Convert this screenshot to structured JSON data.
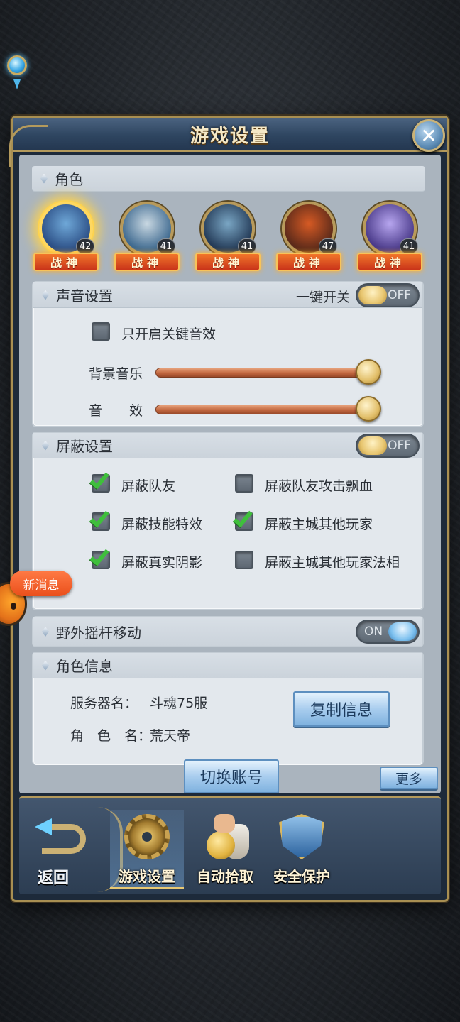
{
  "title": "游戏设置",
  "characters_section": {
    "label": "角色",
    "characters": [
      {
        "level": "42",
        "rank": "战神",
        "colors": [
          "#2c4f86",
          "#6fa8d8"
        ]
      },
      {
        "level": "41",
        "rank": "战神",
        "colors": [
          "#3f6a90",
          "#c9d8e2"
        ]
      },
      {
        "level": "41",
        "rank": "战神",
        "colors": [
          "#243b58",
          "#7aa6c4"
        ]
      },
      {
        "level": "47",
        "rank": "战神",
        "colors": [
          "#5b2a1a",
          "#d65a24"
        ]
      },
      {
        "level": "41",
        "rank": "战神",
        "colors": [
          "#4a3a8a",
          "#b7a6ef"
        ]
      }
    ]
  },
  "sound": {
    "label": "声音设置",
    "master_label": "一键开关",
    "master_toggle": "OFF",
    "key_sound_only": "只开启关键音效",
    "key_sound_checked": false,
    "bgm_label": "背景音乐",
    "bgm_level": 1.0,
    "sfx_label": "音　　效",
    "sfx_level": 1.0
  },
  "shield": {
    "label": "屏蔽设置",
    "toggle": "OFF",
    "options": [
      {
        "label": "屏蔽队友",
        "checked": true
      },
      {
        "label": "屏蔽队友攻击飘血",
        "checked": false
      },
      {
        "label": "屏蔽技能特效",
        "checked": true
      },
      {
        "label": "屏蔽主城其他玩家",
        "checked": true
      },
      {
        "label": "屏蔽真实阴影",
        "checked": true
      },
      {
        "label": "屏蔽主城其他玩家法相",
        "checked": false
      }
    ]
  },
  "joystick": {
    "label": "野外摇杆移动",
    "toggle": "ON"
  },
  "role_info": {
    "label": "角色信息",
    "server_label": "服务器名：",
    "server_value": "斗魂75服",
    "role_label": "角　色　名：",
    "role_value": "荒天帝",
    "copy_button": "复制信息"
  },
  "switch_account": "切换账号",
  "more": "更多",
  "new_message": "新消息",
  "bottom_nav": {
    "back": "返回",
    "tabs": [
      "游戏设置",
      "自动拾取",
      "安全保护"
    ]
  },
  "colors": {
    "panel_gold": "#a88f52",
    "toggle_off_knob": "#e8c670",
    "toggle_on_knob": "#7ec1ef",
    "check_green": "#3fbf3c",
    "rank_orange": "#f2762a"
  }
}
